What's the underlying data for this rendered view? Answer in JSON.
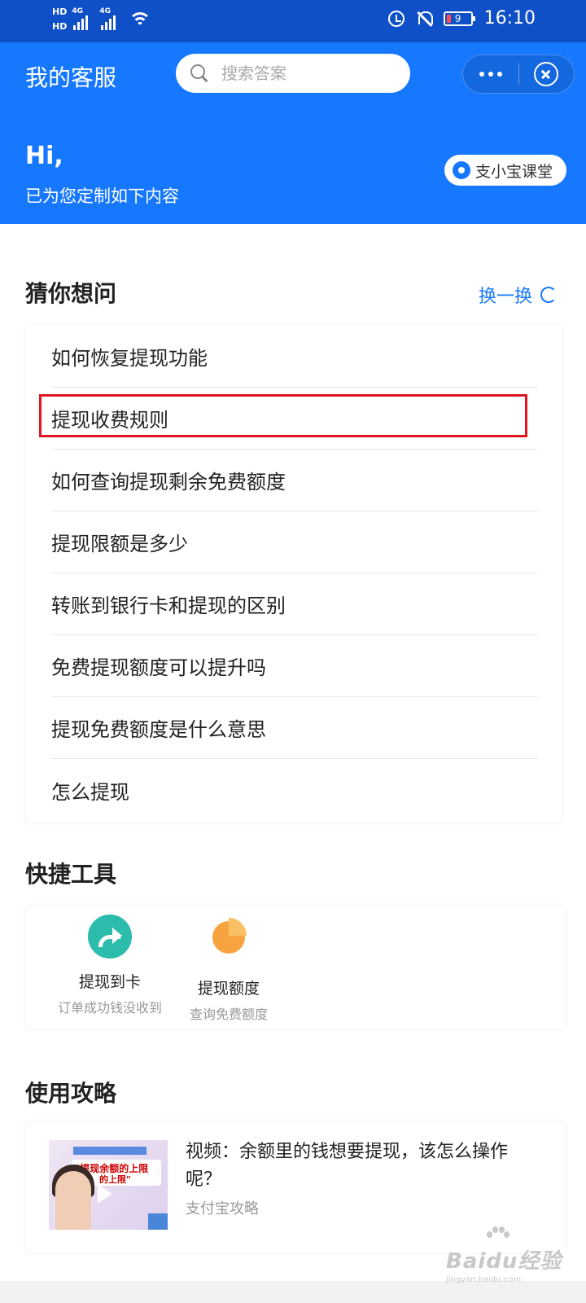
{
  "status_bar": {
    "hd_label_1": "HD",
    "hd_label_2": "HD",
    "net_1": "4G",
    "net_2": "4G",
    "battery": "9",
    "time": "16:10"
  },
  "header": {
    "title": "我的客服",
    "search_placeholder": "搜索答案"
  },
  "greeting": {
    "hi": "Hi,",
    "subtitle": "已为您定制如下内容",
    "classroom_button": "支小宝课堂"
  },
  "faq": {
    "section_title": "猜你想问",
    "refresh_label": "换一换",
    "items": [
      "如何恢复提现功能",
      "提现收费规则",
      "如何查询提现剩余免费额度",
      "提现限额是多少",
      "转账到银行卡和提现的区别",
      "免费提现额度可以提升吗",
      "提现免费额度是什么意思",
      "怎么提现"
    ],
    "highlighted_index": 1
  },
  "tools": {
    "section_title": "快捷工具",
    "items": [
      {
        "name": "提现到卡",
        "desc": "订单成功钱没收到",
        "icon": "arrow-share-icon"
      },
      {
        "name": "提现额度",
        "desc": "查询免费额度",
        "icon": "pie-chart-icon"
      }
    ]
  },
  "guides": {
    "section_title": "使用攻略",
    "items": [
      {
        "title": "视频：余额里的钱想要提现，该怎么操作呢？",
        "source": "支付宝攻略",
        "thumb_text_1": "\"提现余额的上限",
        "thumb_text_2": "的上限\""
      }
    ]
  },
  "watermark": {
    "main": "Baidu经验",
    "sub": "jingyan.baidu.com"
  },
  "colors": {
    "brand_blue": "#1677ff",
    "highlight_red": "#e0151f"
  }
}
